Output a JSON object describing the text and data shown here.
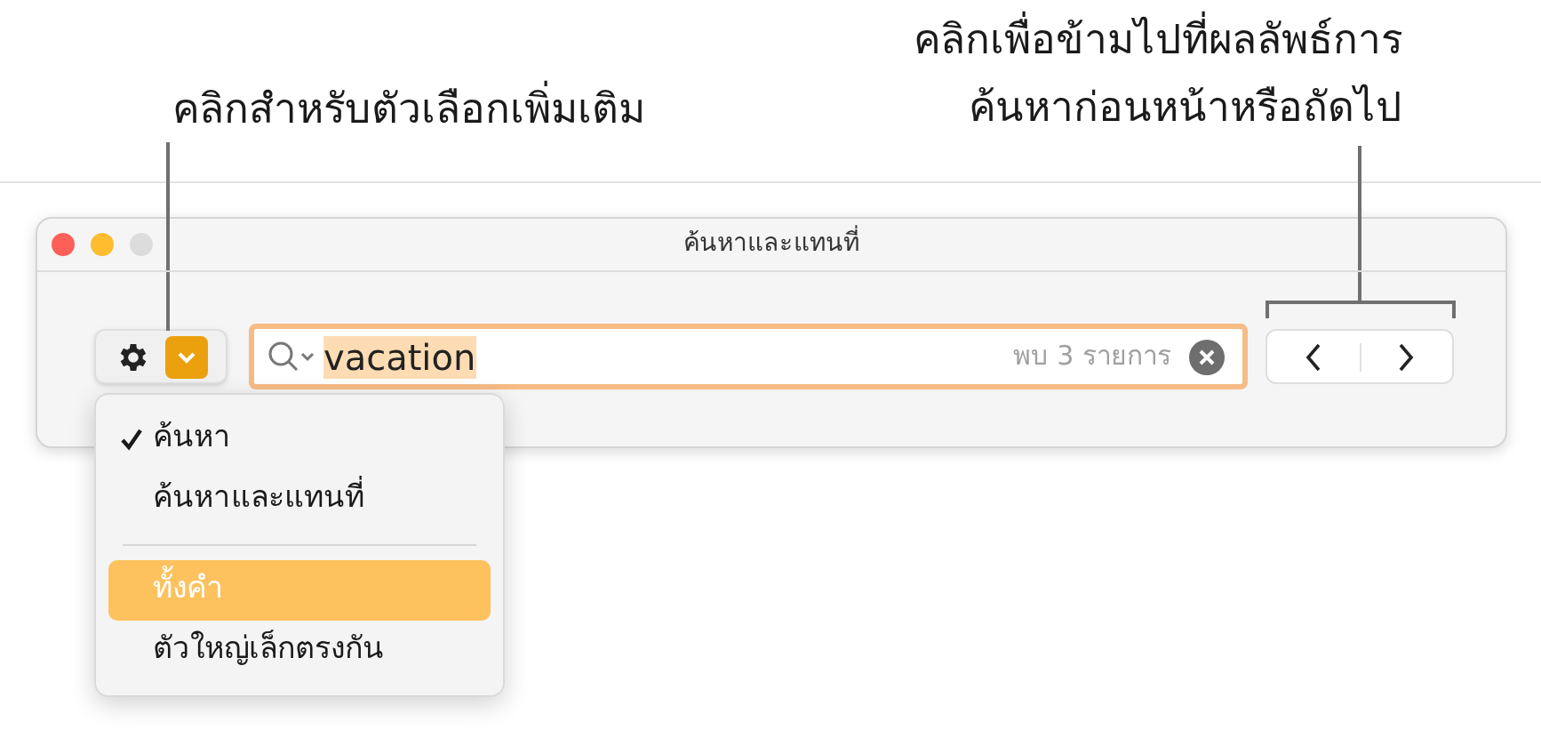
{
  "callouts": [
    {
      "lines": [
        "คลิกสำหรับตัวเลือกเพิ่มเติม"
      ]
    },
    {
      "lines": [
        "คลิกเพื่อข้ามไปที่ผลลัพธ์การ",
        "ค้นหาก่อนหน้าหรือถัดไป"
      ]
    }
  ],
  "window": {
    "title": "ค้นหาและแทนที่"
  },
  "search_field": {
    "value": "vacation",
    "match_count": "พบ 3 รายการ"
  },
  "options_menu": {
    "items": [
      {
        "kind": "item",
        "label": "ค้นหา",
        "checked": true,
        "selected": false
      },
      {
        "kind": "item",
        "label": "ค้นหาและแทนที่",
        "checked": false,
        "selected": false
      },
      {
        "kind": "separator"
      },
      {
        "kind": "item",
        "label": "ทั้งคำ",
        "checked": false,
        "selected": true
      },
      {
        "kind": "item",
        "label": "ตัวใหญ่เล็กตรงกัน",
        "checked": false,
        "selected": false
      }
    ]
  }
}
